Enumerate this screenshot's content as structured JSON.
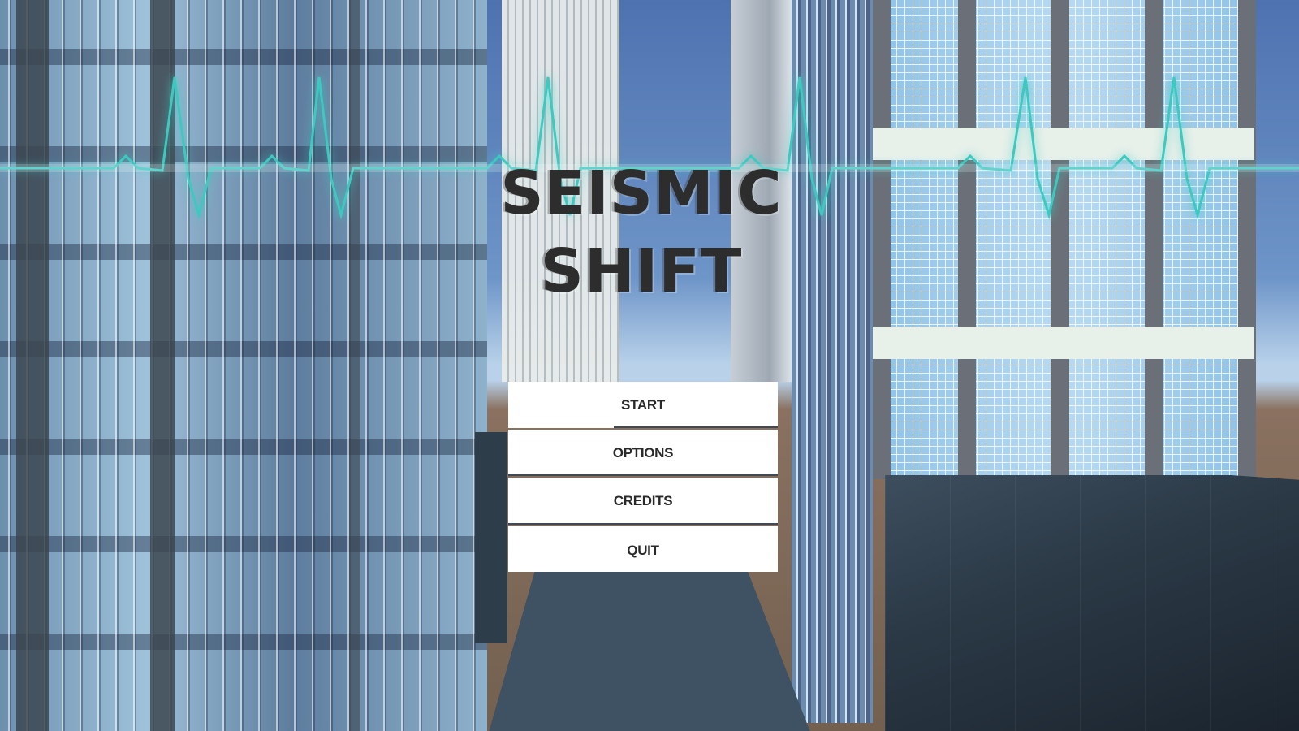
{
  "game": {
    "title_line1": "SEISMIC",
    "title_line2": "SHIFT"
  },
  "menu": {
    "start_label": "START",
    "options_label": "OPTIONS",
    "credits_label": "CREDITS",
    "quit_label": "QUIT"
  },
  "colors": {
    "heartbeat": "#3ec9c0",
    "button_bg": "#ffffff",
    "title_text": "#2d2d2d"
  }
}
